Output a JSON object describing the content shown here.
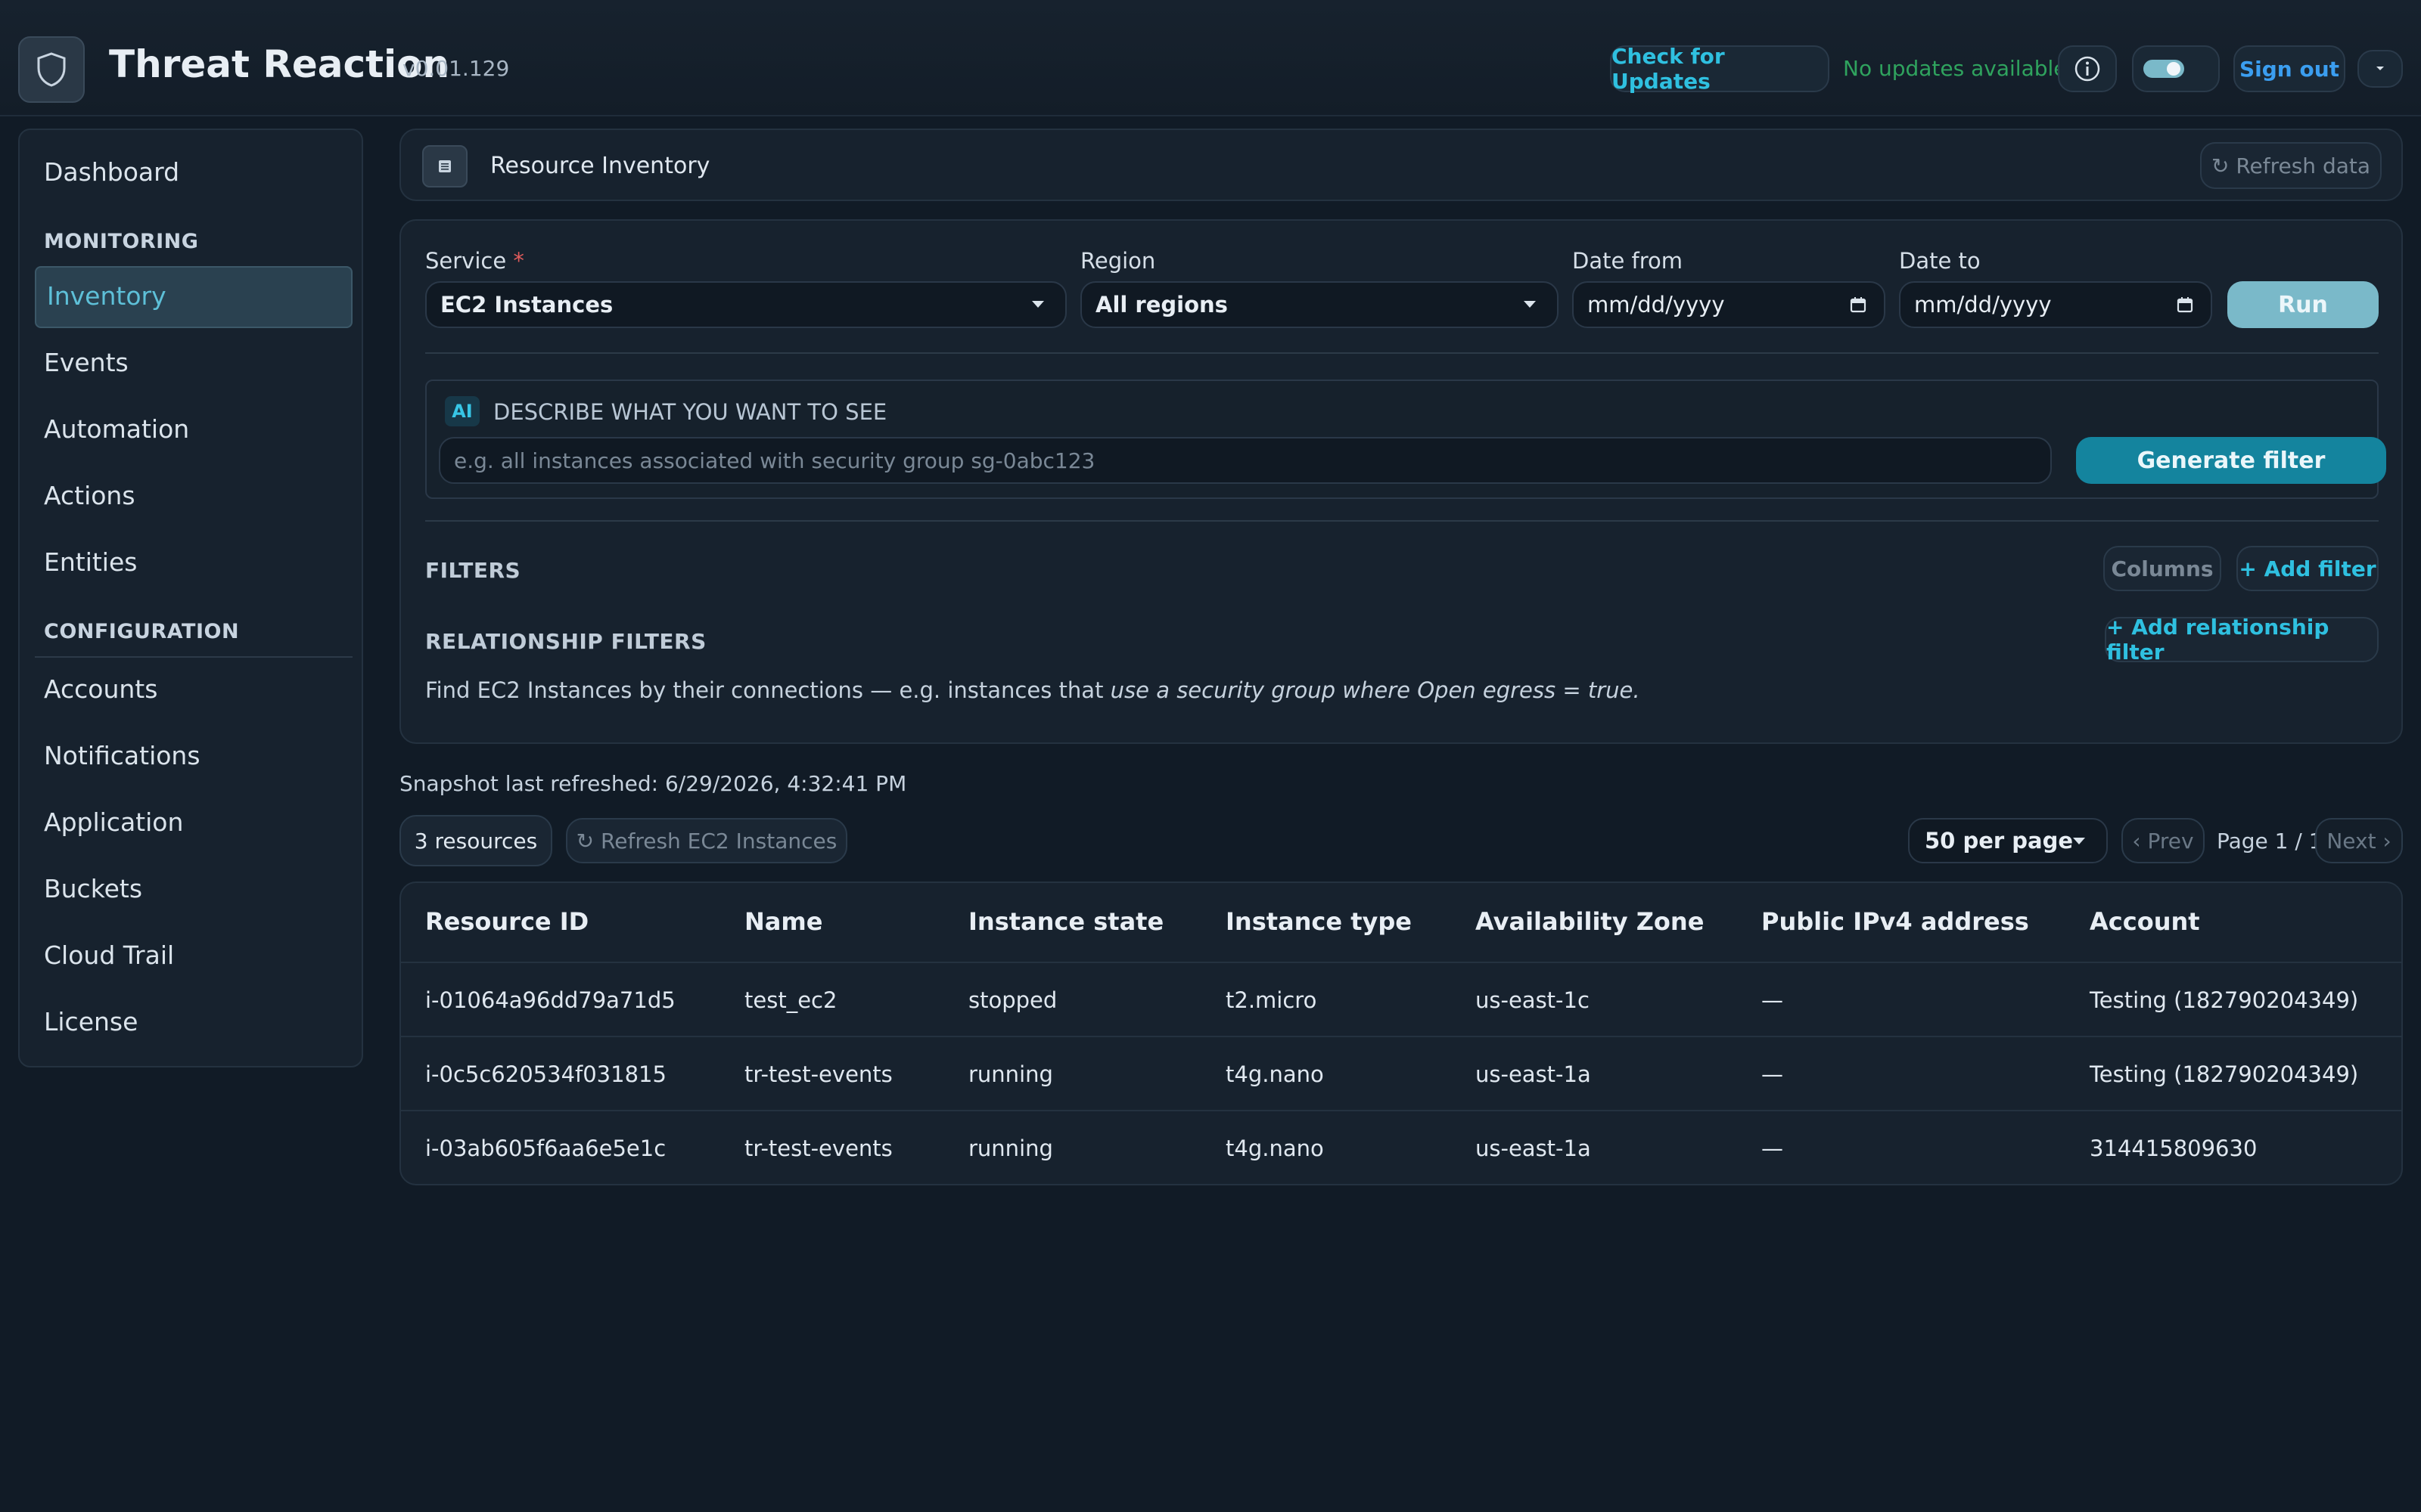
{
  "app": {
    "title": "Threat Reaction",
    "version": "v0.01.129",
    "check_updates": "Check for Updates",
    "update_status": "No updates available",
    "sign_out": "Sign out"
  },
  "sidebar": {
    "dashboard": "Dashboard",
    "monitoring_heading": "MONITORING",
    "monitoring": [
      "Inventory",
      "Events",
      "Automation",
      "Actions",
      "Entities"
    ],
    "configuration_heading": "CONFIGURATION",
    "configuration": [
      "Accounts",
      "Notifications",
      "Application",
      "Buckets",
      "Cloud Trail",
      "License"
    ],
    "active": "Inventory"
  },
  "header": {
    "title": "Resource Inventory",
    "refresh": "↻ Refresh data"
  },
  "query": {
    "service_label": "Service",
    "service_required": "*",
    "service_value": "EC2 Instances",
    "region_label": "Region",
    "region_value": "All regions",
    "date_from_label": "Date from",
    "date_from_value": "mm/dd/yyyy",
    "date_to_label": "Date to",
    "date_to_value": "mm/dd/yyyy",
    "run": "Run"
  },
  "ai": {
    "badge": "AI",
    "title": "DESCRIBE WHAT YOU WANT TO SEE",
    "placeholder": "e.g. all instances associated with security group sg-0abc123",
    "generate": "Generate filter"
  },
  "filters": {
    "heading": "FILTERS",
    "columns": "Columns",
    "add_filter": "+ Add filter",
    "rel_heading": "RELATIONSHIP FILTERS",
    "add_rel_filter": "+ Add relationship filter",
    "rel_hint_prefix": "Find EC2 Instances by their connections — e.g. instances that ",
    "rel_hint_em": "use a security group where Open egress = true."
  },
  "results": {
    "snapshot": "Snapshot last refreshed: 6/29/2026, 4:32:41 PM",
    "count": "3 resources",
    "refresh": "↻ Refresh EC2 Instances",
    "per_page": "50 per page",
    "prev": "‹ Prev",
    "page": "Page 1 / 1",
    "next": "Next ›"
  },
  "table": {
    "columns": [
      "Resource ID",
      "Name",
      "Instance state",
      "Instance type",
      "Availability Zone",
      "Public IPv4 address",
      "Account"
    ],
    "rows": [
      [
        "i-01064a96dd79a71d5",
        "test_ec2",
        "stopped",
        "t2.micro",
        "us-east-1c",
        "—",
        "Testing (182790204349)"
      ],
      [
        "i-0c5c620534f031815",
        "tr-test-events",
        "running",
        "t4g.nano",
        "us-east-1a",
        "—",
        "Testing (182790204349)"
      ],
      [
        "i-03ab605f6aa6e5e1c",
        "tr-test-events",
        "running",
        "t4g.nano",
        "us-east-1a",
        "—",
        "314415809630"
      ]
    ]
  },
  "colors": {
    "accent": "#2fc0e0",
    "success": "#2fa35e",
    "background": "#111b26"
  }
}
